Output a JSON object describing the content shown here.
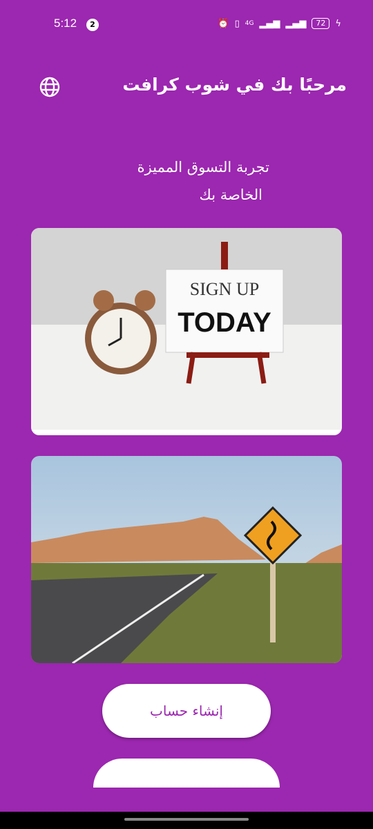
{
  "status_bar": {
    "time": "5:12",
    "notification_count": "2",
    "network": "4G",
    "battery": "72"
  },
  "header": {
    "title": "مرحبًا بك في شوب كرافت",
    "language_icon": "globe-icon"
  },
  "subtitle": {
    "line1": "تجربة التسوق المميزة",
    "line2": "الخاصة بك"
  },
  "images": [
    {
      "sign_line1": "SIGN UP",
      "sign_line2": "TODAY"
    },
    {
      "description_icon": "winding-road-sign"
    }
  ],
  "buttons": {
    "create_account": "إنشاء حساب"
  },
  "colors": {
    "primary": "#9c27b0",
    "button_bg": "#ffffff"
  }
}
